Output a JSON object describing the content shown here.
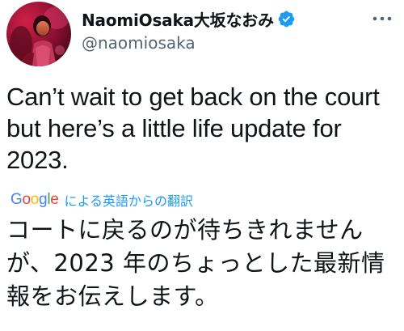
{
  "author": {
    "display_name": "NaomiOsaka大坂なおみ",
    "handle": "@naomiosaka",
    "verified": true,
    "avatar": "profile-photo"
  },
  "menu": {
    "icon": "more-horizontal-icon"
  },
  "tweet": {
    "text": "Can’t wait to get back on the court but here’s a little life update for 2023."
  },
  "translation": {
    "provider": "Google",
    "label": "による英語からの翻訳",
    "text": "コートに戻るのが待ちきれませんが、2023 年のちょっとした最新情報をお伝えします。"
  },
  "colors": {
    "accent": "#1d9bf0",
    "secondary_text": "#536471",
    "primary_text": "#0f1419",
    "google_blue": "#4285f4",
    "google_red": "#ea4335",
    "google_yellow": "#fbbc05",
    "google_green": "#34a853"
  }
}
